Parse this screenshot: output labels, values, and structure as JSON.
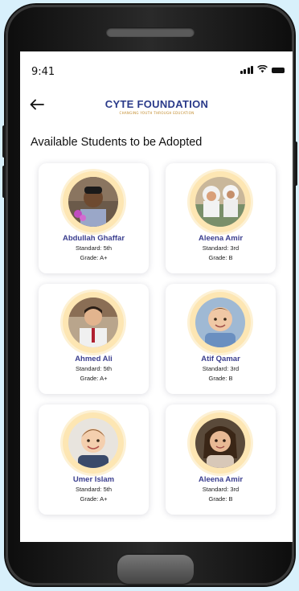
{
  "status_bar": {
    "time": "9:41"
  },
  "header": {
    "title": "CYTE FOUNDATION",
    "tagline": "CHANGING YOUTH THROUGH EDUCATION"
  },
  "heading": "Available Students to be Adopted",
  "students": [
    {
      "name": "Abdullah Ghaffar",
      "standard": "Standard: 5th",
      "grade": "Grade: A+"
    },
    {
      "name": "Aleena Amir",
      "standard": "Standard: 3rd",
      "grade": "Grade: B"
    },
    {
      "name": "Ahmed Ali",
      "standard": "Standard: 5th",
      "grade": "Grade: A+"
    },
    {
      "name": "Atif Qamar",
      "standard": "Standard: 3rd",
      "grade": "Grade: B"
    },
    {
      "name": "Umer Islam",
      "standard": "Standard: 5th",
      "grade": "Grade: A+"
    },
    {
      "name": "Aleena Amir",
      "standard": "Standard: 3rd",
      "grade": "Grade: B"
    }
  ],
  "colors": {
    "brand": "#2a3a8a",
    "name_text": "#3b3f8f",
    "avatar_ring": "#fde6b3",
    "background": "#d8f0fb"
  },
  "icons": [
    "back-arrow-icon",
    "signal-icon",
    "wifi-icon",
    "battery-icon"
  ]
}
